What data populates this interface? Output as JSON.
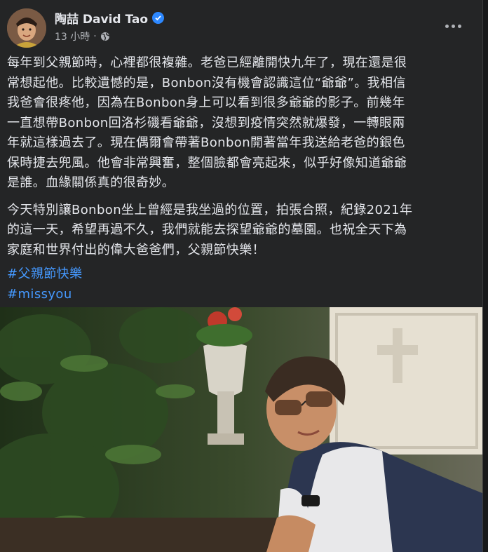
{
  "post": {
    "author": "陶喆 David Tao",
    "time": "13 小時",
    "separator": "·",
    "paragraph1": "每年到父親節時，心裡都很複雜。老爸已經離開快九年了，現在還是很\n常想起他。比較遺憾的是，Bonbon沒有機會認識這位“爺爺”。我相信\n我爸會很疼他，因為在Bonbon身上可以看到很多爺爺的影子。前幾年\n一直想帶Bonbon回洛杉磯看爺爺，沒想到疫情突然就爆發，一轉眼兩\n年就這樣過去了。現在偶爾會帶著Bonbon開著當年我送給老爸的銀色\n保時捷去兜風。他會非常興奮，整個臉都會亮起來，似乎好像知道爺爺\n是誰。血緣關係真的很奇妙。",
    "paragraph2": "今天特別讓Bonbon坐上曾經是我坐過的位置，拍張合照，紀錄2021年\n的這一天，希望再過不久，我們就能去探望爺爺的墓園。也祝全天下為\n家庭和世界付出的偉大爸爸們，父親節快樂！",
    "hashtags": [
      "#父親節快樂",
      "#missyou"
    ]
  },
  "icons": {
    "verified": "verified-badge-icon",
    "audience": "globe-public-icon",
    "more": "more-options-icon"
  },
  "colors": {
    "background": "#242526",
    "text": "#e4e6eb",
    "secondary_text": "#b0b3b8",
    "link": "#4599ff",
    "verified": "#2d88ff"
  }
}
